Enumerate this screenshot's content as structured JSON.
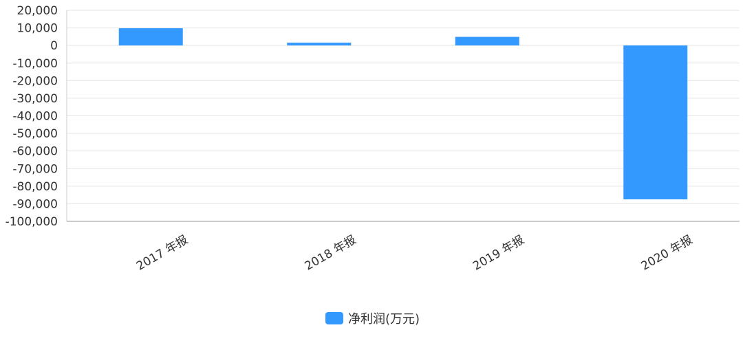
{
  "chart_data": {
    "type": "bar",
    "categories": [
      "2017 年报",
      "2018 年报",
      "2019 年报",
      "2020 年报"
    ],
    "series": [
      {
        "name": "净利润(万元)",
        "values": [
          9800,
          1600,
          4900,
          -87500
        ]
      }
    ],
    "ylim": [
      -100000,
      20000
    ],
    "yticks": [
      20000,
      10000,
      0,
      -10000,
      -20000,
      -30000,
      -40000,
      -50000,
      -60000,
      -70000,
      -80000,
      -90000,
      -100000
    ],
    "ytick_labels": [
      "20,000",
      "10,000",
      "0",
      "-10,000",
      "-20,000",
      "-30,000",
      "-40,000",
      "-50,000",
      "-60,000",
      "-70,000",
      "-80,000",
      "-90,000",
      "-100,000"
    ],
    "grid": true,
    "legend_position": "bottom-center",
    "colors": {
      "bar": "#3399FF",
      "grid": "#E5E5E5",
      "axis": "#CCCCCC",
      "text": "#333333"
    }
  }
}
